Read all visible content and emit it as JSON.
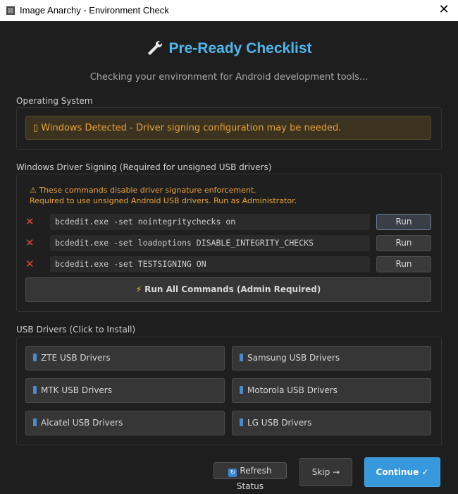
{
  "window": {
    "title": "Image Anarchy - Environment Check",
    "close_symbol": "✕"
  },
  "header": {
    "title": "Pre-Ready Checklist",
    "subtitle": "Checking your environment for Android development tools..."
  },
  "os_section": {
    "label": "Operating System",
    "banner": "▯ Windows Detected - Driver signing configuration may be needed."
  },
  "signing_section": {
    "label": "Windows Driver Signing (Required for unsigned USB drivers)",
    "warning_line1": "⚠ These commands disable driver signature enforcement.",
    "warning_line2": "Required to use unsigned Android USB drivers. Run as Administrator.",
    "status_symbol": "✕",
    "commands": [
      {
        "text": "bcdedit.exe -set nointegritychecks on",
        "button": "Run"
      },
      {
        "text": "bcdedit.exe -set loadoptions DISABLE_INTEGRITY_CHECKS",
        "button": "Run"
      },
      {
        "text": "bcdedit.exe -set TESTSIGNING ON",
        "button": "Run"
      }
    ],
    "run_all_label": "Run All Commands (Admin Required)",
    "run_all_icon": "⚡"
  },
  "usb_section": {
    "label": "USB Drivers (Click to Install)",
    "drivers": [
      "ZTE USB Drivers",
      "Samsung USB Drivers",
      "MTK USB Drivers",
      "Motorola USB Drivers",
      "Alcatel USB Drivers",
      "LG USB Drivers"
    ]
  },
  "footer": {
    "refresh_label": "Refresh Status",
    "refresh_icon": "↻",
    "skip_label": "Skip →",
    "continue_label": "Continue ✓"
  },
  "colors": {
    "accent": "#4fb7ec",
    "warning": "#e8a33b",
    "error": "#e0453c",
    "primary_button": "#3798dc"
  },
  "icons": {
    "wrench": "wrench-icon",
    "phone": "phone-icon",
    "refresh": "refresh-icon",
    "bolt": "bolt-icon"
  }
}
